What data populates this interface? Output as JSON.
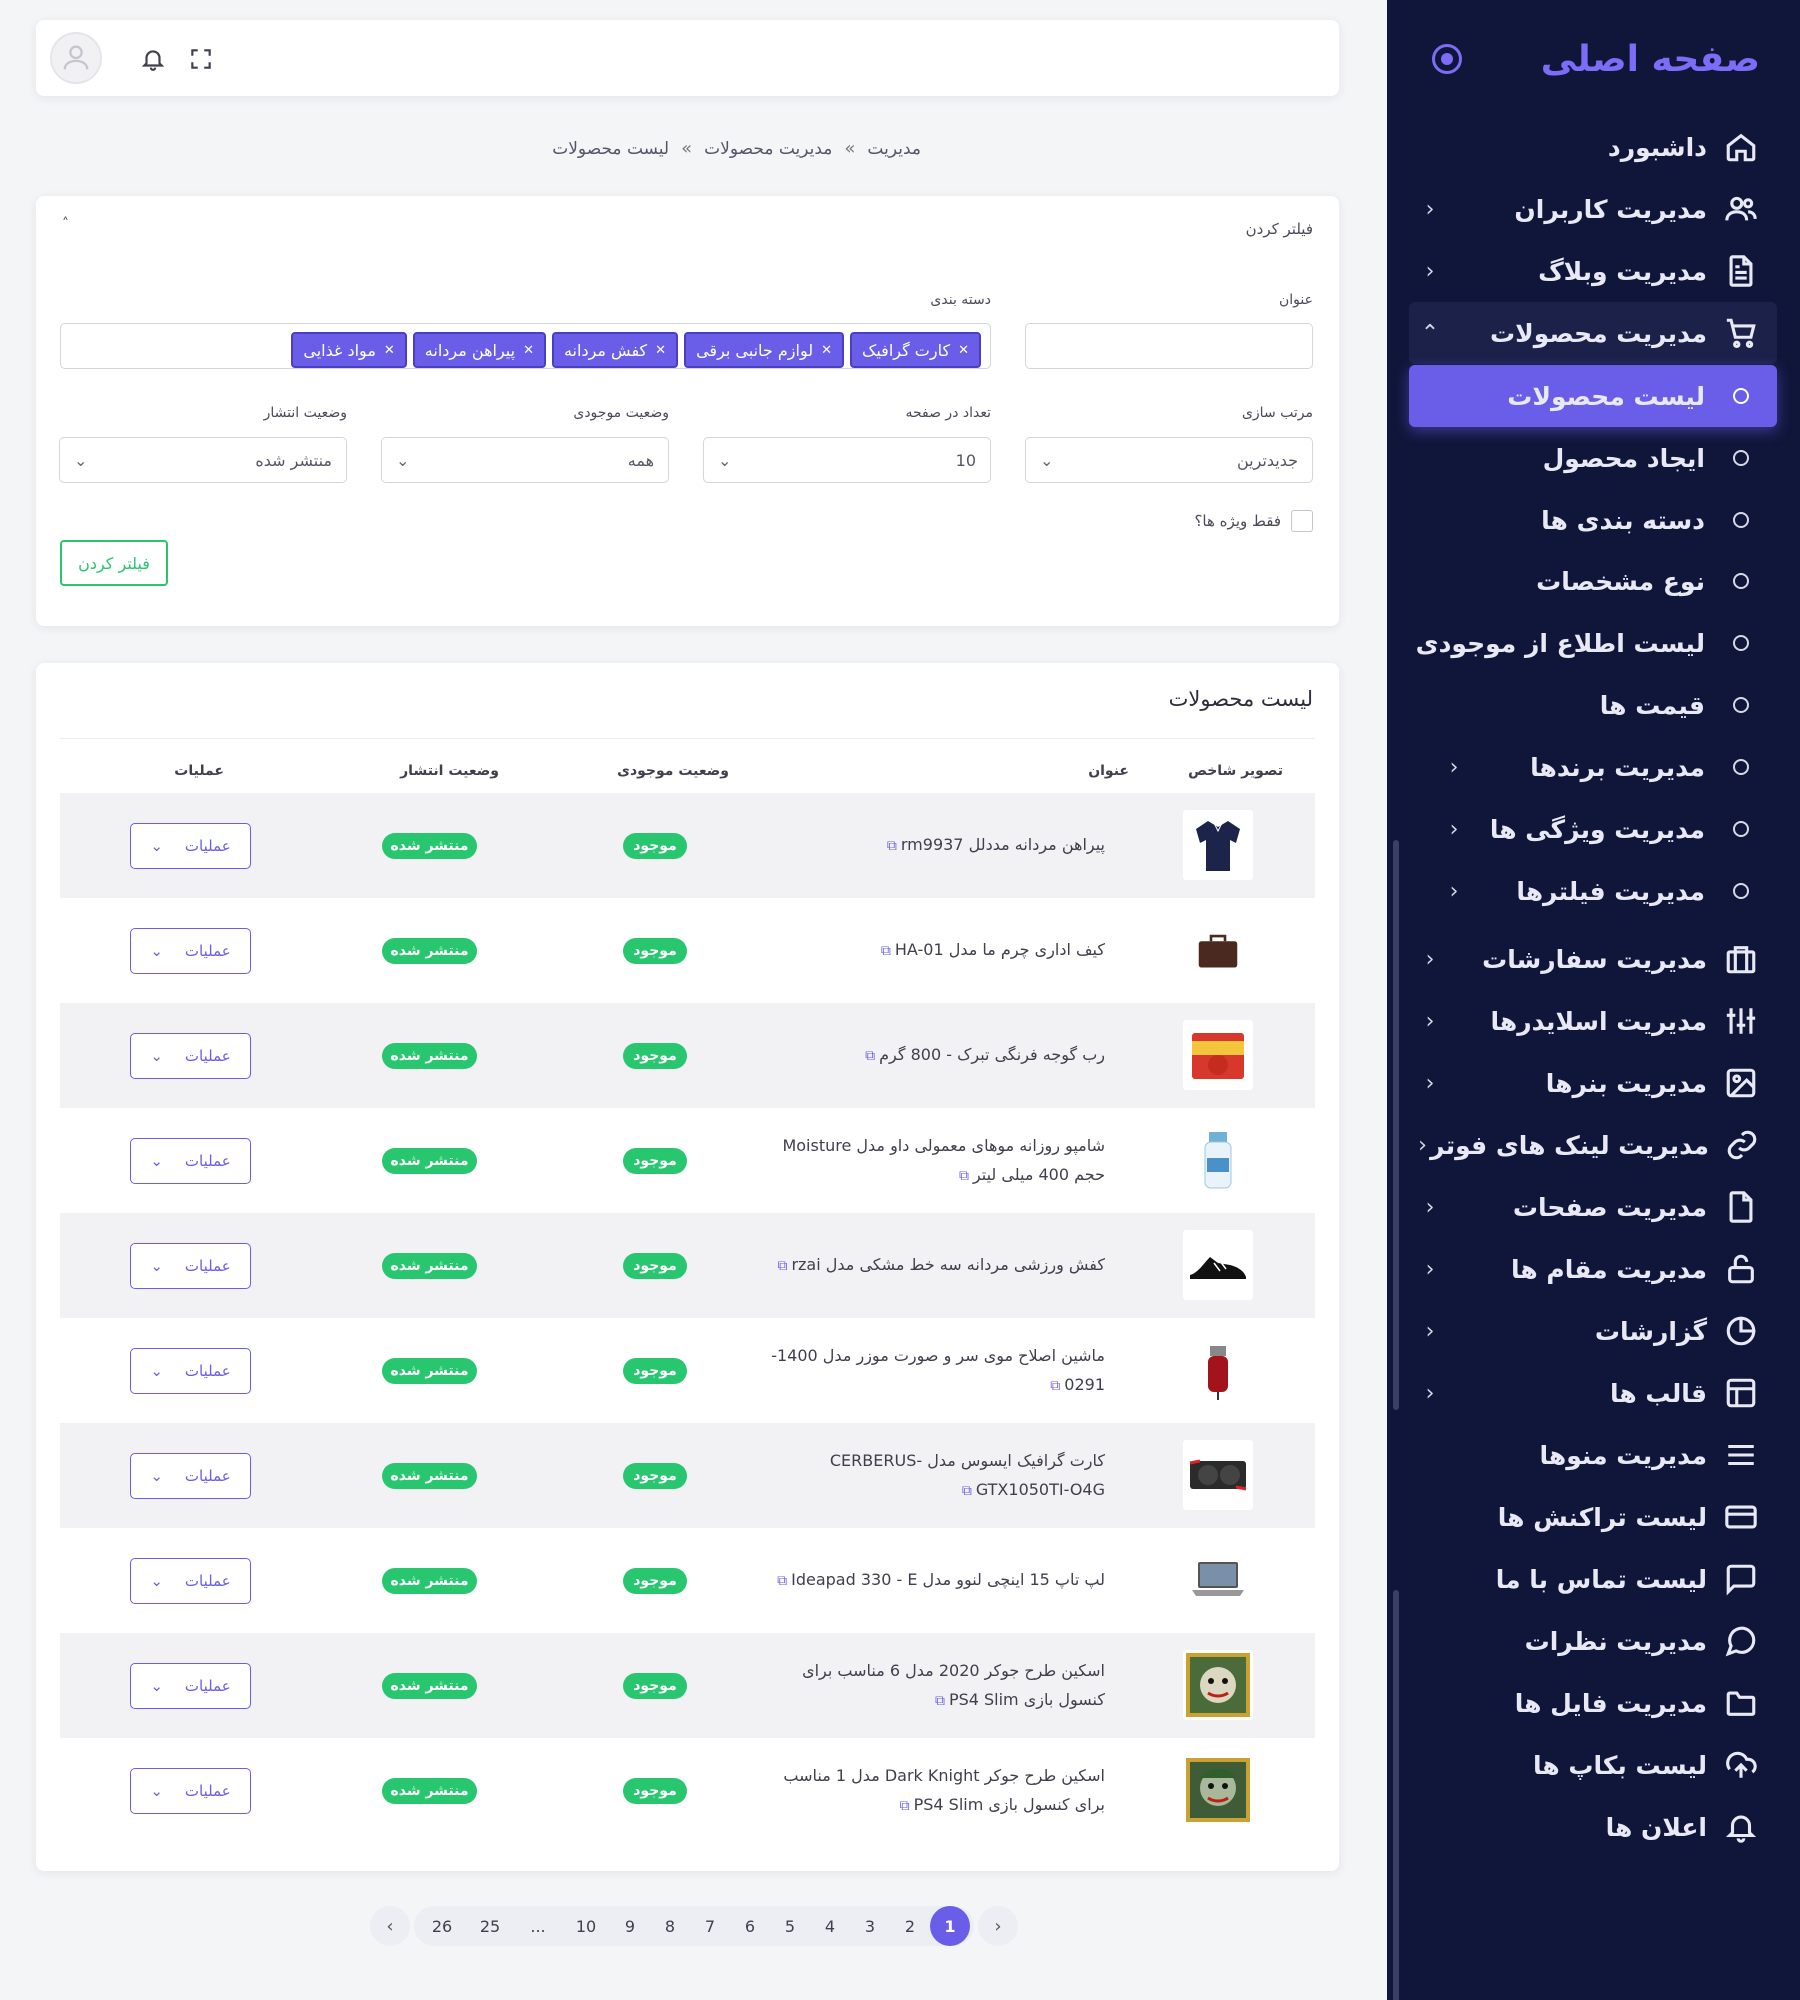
{
  "sidebar": {
    "brand": "صفحه اصلی",
    "items": [
      {
        "label": "داشبورد",
        "icon": "home-icon"
      },
      {
        "label": "مدیریت کاربران",
        "icon": "users-icon"
      },
      {
        "label": "مدیریت وبلاگ",
        "icon": "file-text-icon"
      },
      {
        "label": "مدیریت محصولات",
        "icon": "cart-icon"
      }
    ],
    "sub_items": [
      {
        "label": "لیست محصولات"
      },
      {
        "label": "ایجاد محصول"
      },
      {
        "label": "دسته بندی ها"
      },
      {
        "label": "نوع مشخصات"
      },
      {
        "label": "لیست اطلاع از موجودی"
      },
      {
        "label": "قیمت ها"
      },
      {
        "label": "مدیریت برندها"
      },
      {
        "label": "مدیریت ویژگی ها"
      },
      {
        "label": "مدیریت فیلترها"
      }
    ],
    "items2": [
      {
        "label": "مدیریت سفارشات",
        "icon": "orders-icon"
      },
      {
        "label": "مدیریت اسلایدرها",
        "icon": "sliders-icon"
      },
      {
        "label": "مدیریت بنرها",
        "icon": "image-icon"
      },
      {
        "label": "مدیریت لینک های فوتر",
        "icon": "link-icon"
      },
      {
        "label": "مدیریت صفحات",
        "icon": "page-icon"
      },
      {
        "label": "مدیریت مقام ها",
        "icon": "lock-icon"
      },
      {
        "label": "گزارشات",
        "icon": "pie-chart-icon"
      },
      {
        "label": "قالب ها",
        "icon": "layout-icon"
      },
      {
        "label": "مدیریت منوها",
        "icon": "menu-icon"
      },
      {
        "label": "لیست تراکنش ها",
        "icon": "credit-card-icon"
      },
      {
        "label": "لیست تماس با ما",
        "icon": "message-square-icon"
      },
      {
        "label": "مدیریت نظرات",
        "icon": "message-circle-icon"
      },
      {
        "label": "مدیریت فایل ها",
        "icon": "folder-icon"
      },
      {
        "label": "لیست بکاپ ها",
        "icon": "upload-cloud-icon"
      },
      {
        "label": "اعلان ها",
        "icon": "bell-icon"
      }
    ]
  },
  "breadcrumb": [
    "مدیریت",
    "مدیریت محصولات",
    "لیست محصولات"
  ],
  "breadcrumb_sep": "»",
  "filter": {
    "title": "فیلتر کردن",
    "title_label": "عنوان",
    "title_value": "",
    "category_label": "دسته بندی",
    "tags": [
      "کارت گرافیک",
      "لوازم جانبی برقی",
      "کفش مردانه",
      "پیراهن مردانه",
      "مواد غذایی"
    ],
    "sort_label": "مرتب سازی",
    "sort_value": "جدیدترین",
    "per_page_label": "تعداد در صفحه",
    "per_page_value": "10",
    "stock_label": "وضعیت موجودی",
    "stock_value": "همه",
    "publish_label": "وضعیت انتشار",
    "publish_value": "منتشر شده",
    "special_label": "فقط ویژه ها؟",
    "button": "فیلتر کردن"
  },
  "list": {
    "title": "لیست محصولات",
    "headers": {
      "image": "تصویر شاخص",
      "title": "عنوان",
      "stock": "وضعیت موجودی",
      "publish": "وضعیت انتشار",
      "ops": "عملیات"
    },
    "rows": [
      {
        "title": "پیراهن مردانه مددلل rm9937",
        "stock": "موجود",
        "publish": "منتشر شده",
        "ops": "عملیات",
        "thumb": "shirt"
      },
      {
        "title": "کیف اداری چرم ما مدل HA-01",
        "stock": "موجود",
        "publish": "منتشر شده",
        "ops": "عملیات",
        "thumb": "bag"
      },
      {
        "title": "رب گوجه فرنگی تبرک - 800 گرم",
        "stock": "موجود",
        "publish": "منتشر شده",
        "ops": "عملیات",
        "thumb": "can"
      },
      {
        "title": "شامپو روزانه موهای معمولی داو مدل Moisture حجم 400 میلی لیتر",
        "stock": "موجود",
        "publish": "منتشر شده",
        "ops": "عملیات",
        "thumb": "bottle"
      },
      {
        "title": "کفش ورزشی مردانه سه خط مشکی مدل rzai",
        "stock": "موجود",
        "publish": "منتشر شده",
        "ops": "عملیات",
        "thumb": "shoe"
      },
      {
        "title": "ماشین اصلاح موی سر و صورت موزر مدل 1400-0291",
        "stock": "موجود",
        "publish": "منتشر شده",
        "ops": "عملیات",
        "thumb": "clipper"
      },
      {
        "title": "کارت گرافیک ایسوس مدل CERBERUS-GTX1050TI-O4G",
        "stock": "موجود",
        "publish": "منتشر شده",
        "ops": "عملیات",
        "thumb": "gpu"
      },
      {
        "title": "لپ تاپ 15 اینچی لنوو مدل Ideapad 330 - E",
        "stock": "موجود",
        "publish": "منتشر شده",
        "ops": "عملیات",
        "thumb": "laptop"
      },
      {
        "title": "اسکین طرح جوکر 2020 مدل 6 مناسب برای کنسول بازی PS4 Slim",
        "stock": "موجود",
        "publish": "منتشر شده",
        "ops": "عملیات",
        "thumb": "joker"
      },
      {
        "title": "اسکین طرح جوکر Dark Knight مدل 1 مناسب برای کنسول بازی PS4 Slim",
        "stock": "موجود",
        "publish": "منتشر شده",
        "ops": "عملیات",
        "thumb": "joker2"
      }
    ]
  },
  "pagination": {
    "prev": "‹",
    "next": "›",
    "pages": [
      "1",
      "2",
      "3",
      "4",
      "5",
      "6",
      "7",
      "8",
      "9",
      "10",
      "...",
      "25",
      "26"
    ],
    "active": "1"
  }
}
